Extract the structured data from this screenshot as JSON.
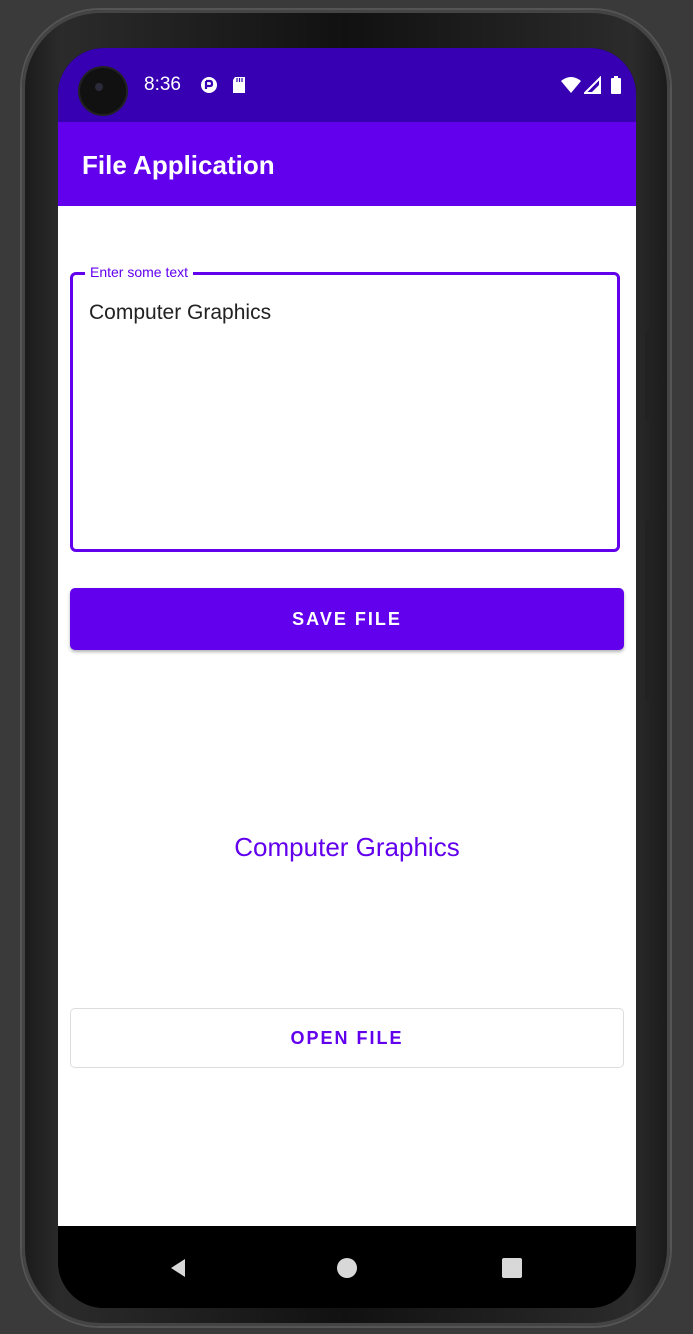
{
  "status_bar": {
    "time": "8:36",
    "icons": [
      "camera-hole-icon",
      "sync-icon",
      "sd-card-icon",
      "wifi-icon",
      "signal-icon",
      "battery-icon"
    ]
  },
  "app_bar": {
    "title": "File Application"
  },
  "text_field": {
    "label": "Enter some text",
    "value": "Computer Graphics"
  },
  "save_button": {
    "label": "SAVE FILE"
  },
  "output_text": "Computer Graphics",
  "open_button": {
    "label": "OPEN FILE"
  },
  "nav_bar": {
    "icons": [
      "back-icon",
      "home-icon",
      "recents-icon"
    ]
  },
  "colors": {
    "primary": "#6200ee",
    "primary_dark": "#3700b3",
    "background": "#ffffff"
  }
}
